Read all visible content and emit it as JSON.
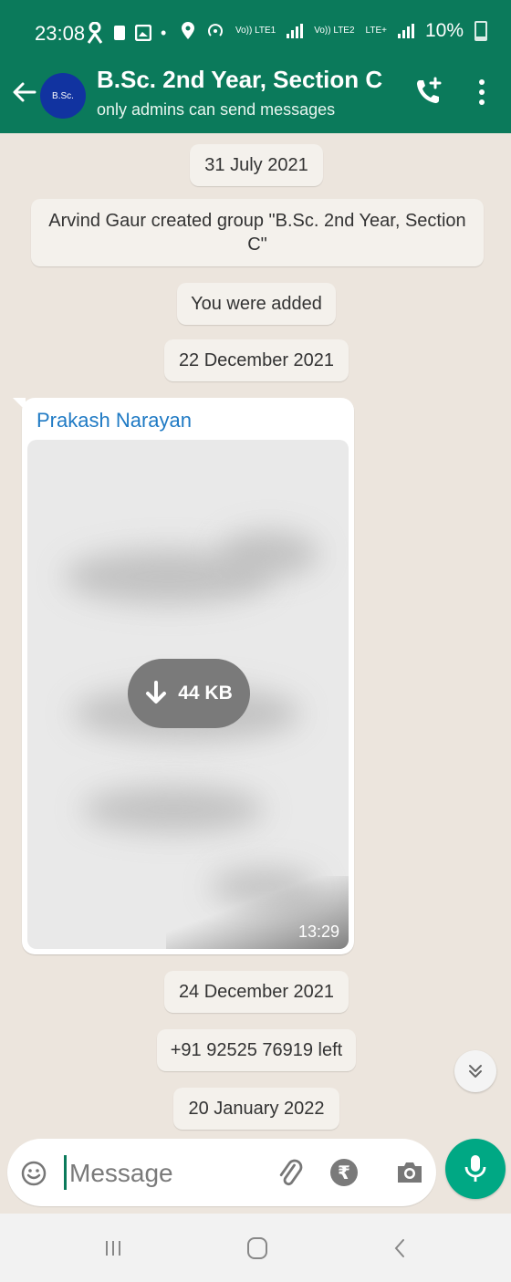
{
  "status_bar": {
    "time": "23:08",
    "sim1_label": "Vo)) LTE1",
    "sim2_label": "Vo)) LTE2",
    "lte_plus": "LTE+",
    "battery": "10%"
  },
  "header": {
    "avatar_text": "B.Sc.",
    "title": "B.Sc. 2nd Year, Section C",
    "subtitle": "only admins can send messages"
  },
  "chat": {
    "date1": "31 July 2021",
    "system_created": "Arvind Gaur created group \"B.Sc. 2nd Year, Section C\"",
    "system_added": "You were added",
    "date2": "22 December 2021",
    "message": {
      "sender": "Prakash Narayan",
      "download_size": "44 KB",
      "time": "13:29"
    },
    "date3": "24 December 2021",
    "system_left": "+91 92525 76919 left",
    "date4": "20 January 2022"
  },
  "input": {
    "placeholder": "Message"
  },
  "colors": {
    "header_bg": "#0b7a5b",
    "chat_bg": "#ece5dd",
    "mic_bg": "#00a884",
    "sender_name": "#1f7ac4"
  },
  "icons": {
    "back": "arrow-left-icon",
    "call": "add-call-icon",
    "more": "more-vertical-icon",
    "emoji": "emoji-icon",
    "attach": "paperclip-icon",
    "payment": "rupee-icon",
    "camera": "camera-icon",
    "mic": "mic-icon",
    "download": "download-arrow-icon",
    "scroll": "double-chevron-down-icon"
  }
}
